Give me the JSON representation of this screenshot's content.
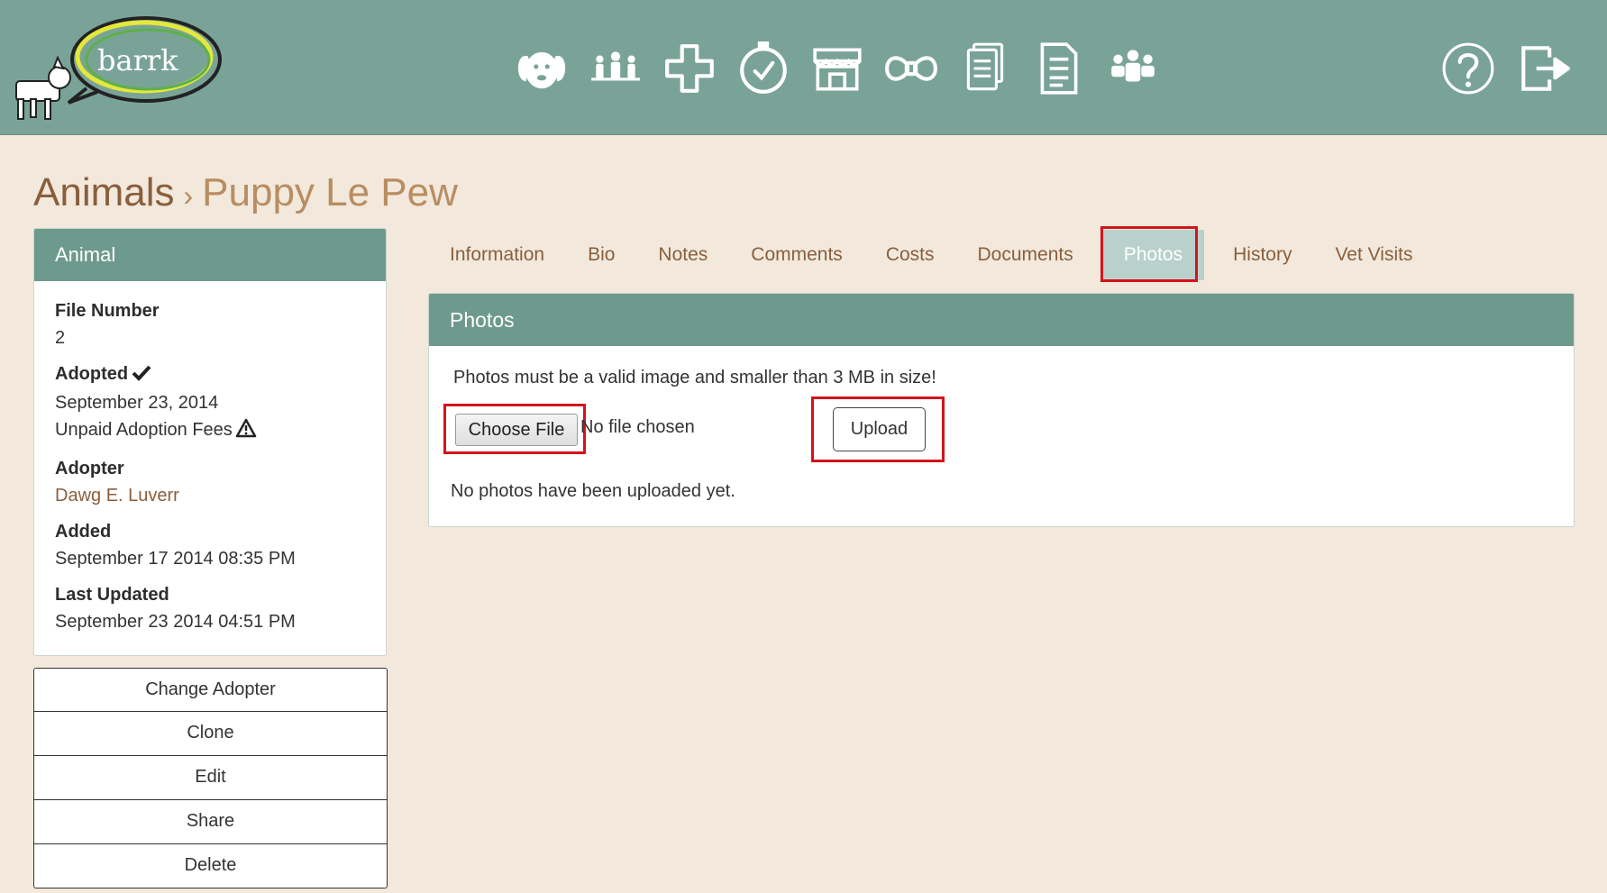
{
  "header": {
    "logo_text": "barrk",
    "nav_icons": [
      "dog-face-icon",
      "family-icon",
      "medical-cross-icon",
      "clock-check-icon",
      "shop-icon",
      "bow-tie-icon",
      "documents-icon",
      "document-icon",
      "team-icon"
    ],
    "right_icons": [
      "help-icon",
      "logout-icon"
    ]
  },
  "breadcrumb": {
    "root": "Animals",
    "separator": "›",
    "current": "Puppy Le Pew"
  },
  "animal_panel": {
    "title": "Animal",
    "file_number_label": "File Number",
    "file_number": "2",
    "adopted_label": "Adopted",
    "adopted_date": "September 23, 2014",
    "unpaid_fees": "Unpaid Adoption Fees",
    "adopter_label": "Adopter",
    "adopter_name": "Dawg E. Luverr",
    "added_label": "Added",
    "added_value": "September 17 2014 08:35 PM",
    "updated_label": "Last Updated",
    "updated_value": "September 23 2014 04:51 PM"
  },
  "actions": [
    "Change Adopter",
    "Clone",
    "Edit",
    "Share",
    "Delete"
  ],
  "tabs": [
    "Information",
    "Bio",
    "Notes",
    "Comments",
    "Costs",
    "Documents",
    "Photos",
    "History",
    "Vet Visits"
  ],
  "active_tab": "Photos",
  "photos_panel": {
    "title": "Photos",
    "notice": "Photos must be a valid image and smaller than 3 MB in size!",
    "choose_label": "Choose File",
    "no_file": "No file chosen",
    "upload_label": "Upload",
    "empty_message": "No photos have been uploaded yet."
  },
  "colors": {
    "header_bg": "#7aa398",
    "panel_head": "#6e9a8d",
    "page_bg": "#f2e9dc",
    "link": "#8a5e3c",
    "highlight": "#d4141b",
    "active_tab": "#b9d1cb"
  }
}
